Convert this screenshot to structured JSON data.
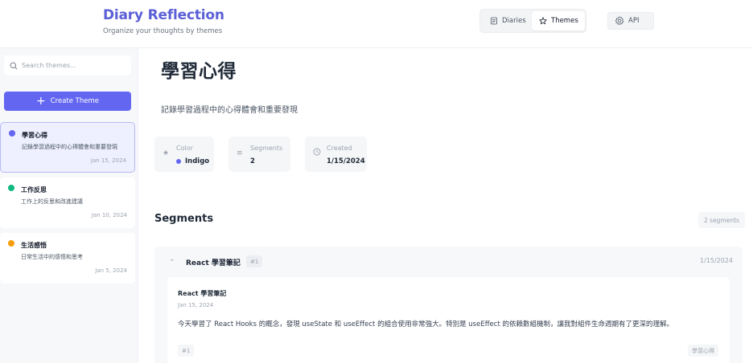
{
  "header": {
    "title": "Diary Reflection",
    "subtitle": "Organize your thoughts by themes",
    "nav": {
      "diaries_label": "Diaries",
      "themes_label": "Themes",
      "active": "Themes"
    },
    "api_label": "API"
  },
  "sidebar": {
    "search_placeholder": "Search themes...",
    "create_label": "Create Theme",
    "themes": [
      {
        "name": "學習心得",
        "description": "記錄學習過程中的心得體會和重要發現",
        "date": "Jan 15, 2024",
        "color": "#6366f1",
        "active": true
      },
      {
        "name": "工作反思",
        "description": "工作上的反思和改進建議",
        "date": "Jan 10, 2024",
        "color": "#10b981",
        "active": false
      },
      {
        "name": "生活感悟",
        "description": "日常生活中的感悟和思考",
        "date": "Jan 5, 2024",
        "color": "#f59e0b",
        "active": false
      }
    ]
  },
  "theme": {
    "title": "學習心得",
    "description": "記錄學習過程中的心得體會和重要發現",
    "stats": {
      "color_label": "Color",
      "color_value": "Indigo",
      "color_hex": "#6366f1",
      "segments_label": "Segments",
      "segments_value": "2",
      "created_label": "Created",
      "created_value": "1/15/2024"
    }
  },
  "segments": {
    "heading": "Segments",
    "count_label": "2 segments",
    "items": [
      {
        "title": "React 學習筆記",
        "number": "#1",
        "date": "1/15/2024",
        "body_title": "React 學習筆記",
        "body_date": "Jan 15, 2024",
        "content": "今天學習了 React Hooks 的概念，發現 useState 和 useEffect 的組合使用非常強大。特別是 useEffect 的依賴數組機制，讓我對組件生命週期有了更深的理解。",
        "footer_number": "#1",
        "tag": "學習心得"
      }
    ]
  }
}
